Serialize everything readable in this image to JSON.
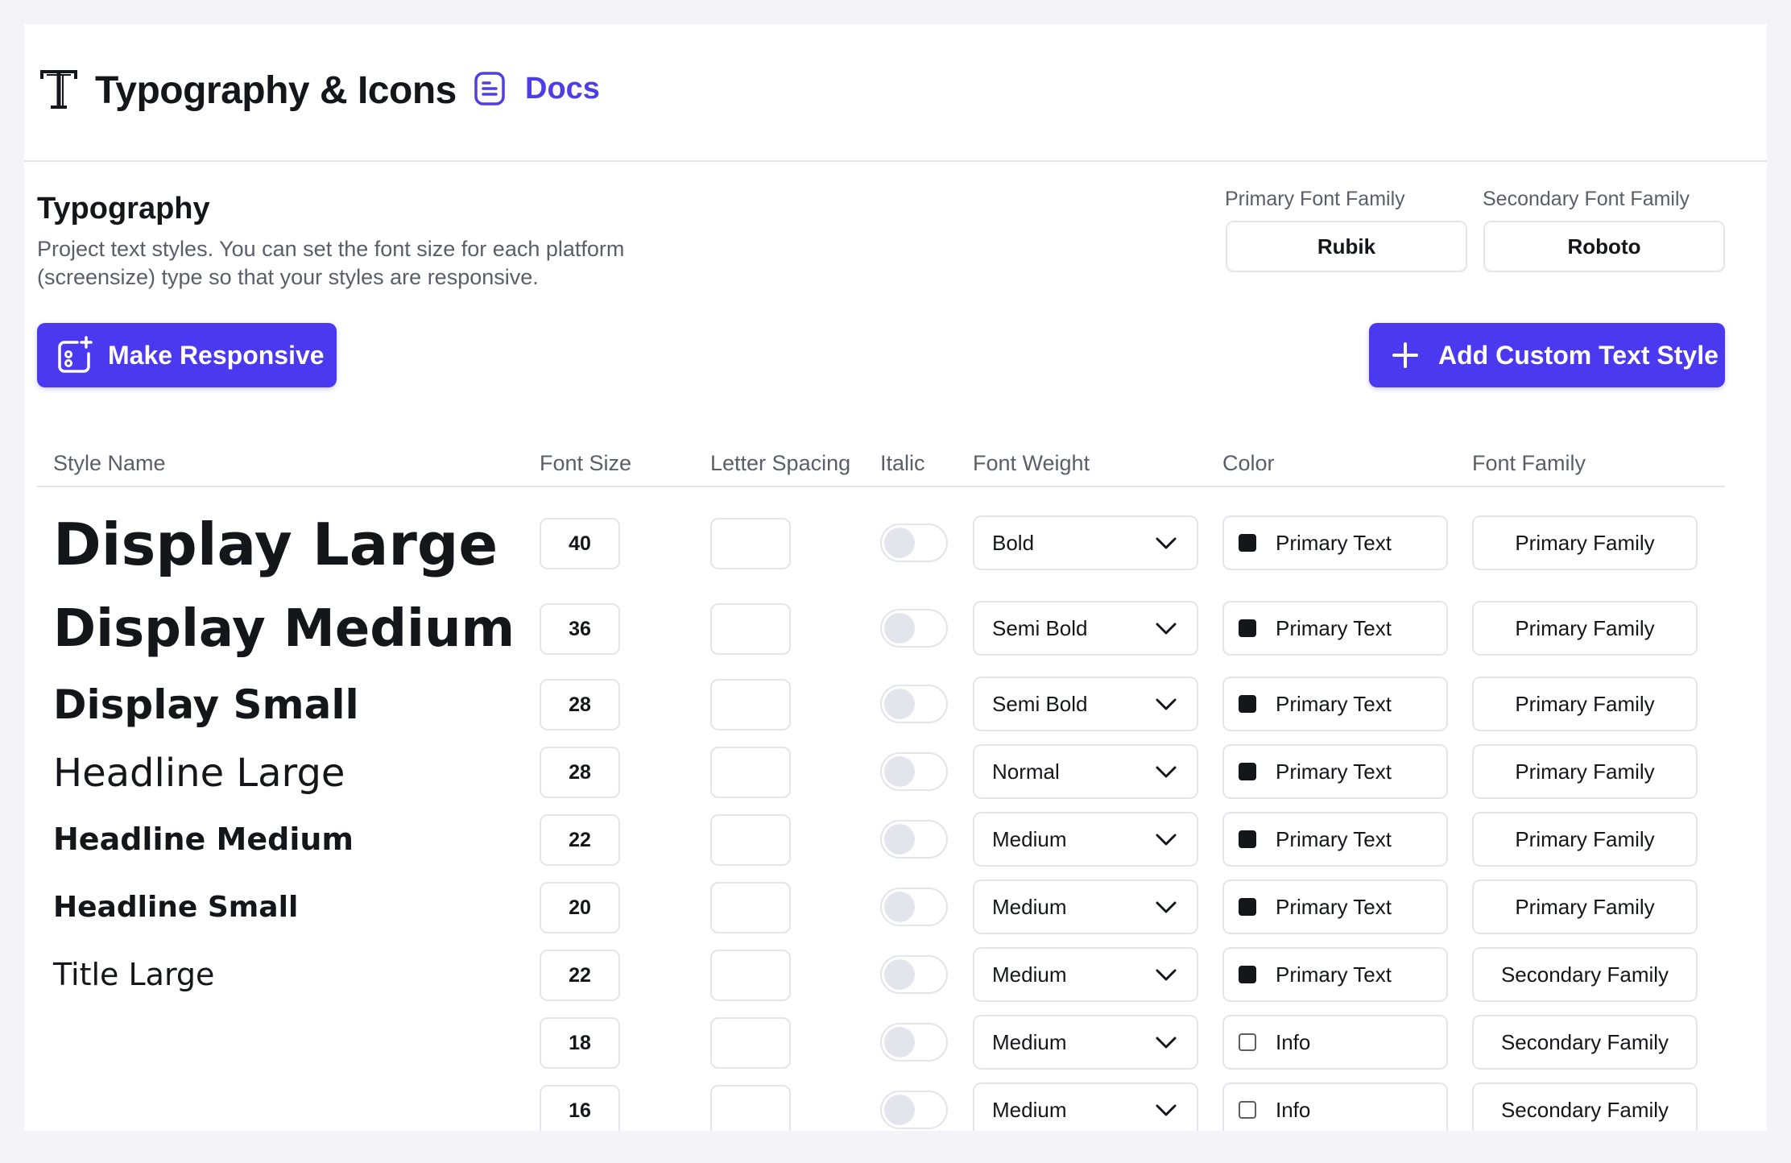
{
  "header": {
    "title": "Typography & Icons",
    "title_icon": "typography-icon",
    "docs_label": "Docs",
    "docs_icon": "document-icon"
  },
  "section": {
    "title": "Typography",
    "description": "Project text styles. You can set the font size for each platform (screensize) type so that your styles are responsive."
  },
  "font_families": {
    "primary_label": "Primary Font Family",
    "primary_value": "Rubik",
    "secondary_label": "Secondary Font Family",
    "secondary_value": "Roboto"
  },
  "buttons": {
    "make_responsive": "Make Responsive",
    "make_responsive_icon": "responsive-layout-icon",
    "add_custom": "Add Custom Text Style",
    "add_custom_icon": "plus-icon"
  },
  "colors": {
    "accent": "#4b39ef",
    "primary_text": "#14161a",
    "secondary_text": "#5b5e68",
    "border": "#e4e5ea"
  },
  "table": {
    "columns": [
      "Style Name",
      "Font Size",
      "Letter Spacing",
      "Italic",
      "Font Weight",
      "Color",
      "Font Family"
    ],
    "rows": [
      {
        "name": "Display Large",
        "font_size": "40",
        "letter_spacing": "",
        "italic": false,
        "weight": "Bold",
        "color_label": "Primary Text",
        "color_hex": "#14161a",
        "family": "Primary Family"
      },
      {
        "name": "Display Medium",
        "font_size": "36",
        "letter_spacing": "",
        "italic": false,
        "weight": "Semi Bold",
        "color_label": "Primary Text",
        "color_hex": "#14161a",
        "family": "Primary Family"
      },
      {
        "name": "Display Small",
        "font_size": "28",
        "letter_spacing": "",
        "italic": false,
        "weight": "Semi Bold",
        "color_label": "Primary Text",
        "color_hex": "#14161a",
        "family": "Primary Family"
      },
      {
        "name": "Headline Large",
        "font_size": "28",
        "letter_spacing": "",
        "italic": false,
        "weight": "Normal",
        "color_label": "Primary Text",
        "color_hex": "#14161a",
        "family": "Primary Family"
      },
      {
        "name": "Headline Medium",
        "font_size": "22",
        "letter_spacing": "",
        "italic": false,
        "weight": "Medium",
        "color_label": "Primary Text",
        "color_hex": "#14161a",
        "family": "Primary Family"
      },
      {
        "name": "Headline Small",
        "font_size": "20",
        "letter_spacing": "",
        "italic": false,
        "weight": "Medium",
        "color_label": "Primary Text",
        "color_hex": "#14161a",
        "family": "Primary Family"
      },
      {
        "name": "Title Large",
        "font_size": "22",
        "letter_spacing": "",
        "italic": false,
        "weight": "Medium",
        "color_label": "Primary Text",
        "color_hex": "#14161a",
        "family": "Secondary Family"
      },
      {
        "name": "",
        "font_size": "18",
        "letter_spacing": "",
        "italic": false,
        "weight": "Medium",
        "color_label": "Info",
        "color_hex": "#ffffff",
        "family": "Secondary Family"
      },
      {
        "name": "",
        "font_size": "16",
        "letter_spacing": "",
        "italic": false,
        "weight": "Medium",
        "color_label": "Info",
        "color_hex": "#ffffff",
        "family": "Secondary Family"
      }
    ]
  }
}
